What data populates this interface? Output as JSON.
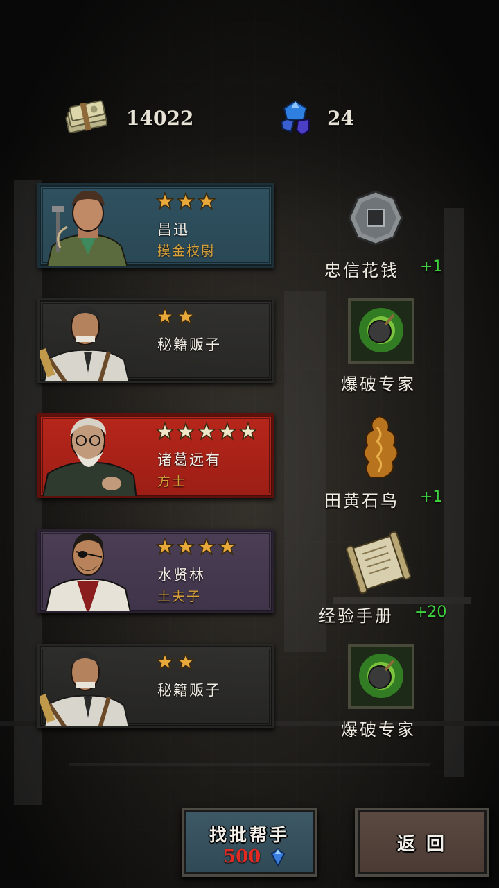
{
  "currency": {
    "money": "14022",
    "gems": "24"
  },
  "recruits": [
    {
      "stars": 3,
      "name": "昌迅",
      "title": "摸金校尉",
      "card_color": "blue",
      "reward": {
        "label": "忠信花钱",
        "count": "+1",
        "icon": "coin-icon"
      }
    },
    {
      "stars": 2,
      "name": "秘籍贩子",
      "title": "",
      "card_color": "gray",
      "reward": {
        "label": "爆破专家",
        "count": "",
        "icon": "bomb-skill-icon"
      }
    },
    {
      "stars": 5,
      "name": "诸葛远有",
      "title": "方士",
      "card_color": "red",
      "reward": {
        "label": "田黄石鸟",
        "count": "+1",
        "icon": "stone-bird-icon"
      }
    },
    {
      "stars": 4,
      "name": "水贤林",
      "title": "土夫子",
      "card_color": "purple",
      "reward": {
        "label": "经验手册",
        "count": "+20",
        "icon": "scroll-icon"
      }
    },
    {
      "stars": 2,
      "name": "秘籍贩子",
      "title": "",
      "card_color": "gray",
      "reward": {
        "label": "爆破专家",
        "count": "",
        "icon": "bomb-skill-icon"
      }
    }
  ],
  "buttons": {
    "hire_label": "找批帮手",
    "hire_price": "500",
    "back_label": "返回"
  },
  "colors": {
    "star_gold": "#e8a93a",
    "count_green": "#3fd33f",
    "title_gold": "#d9a13b",
    "price_red": "#e22a22"
  }
}
